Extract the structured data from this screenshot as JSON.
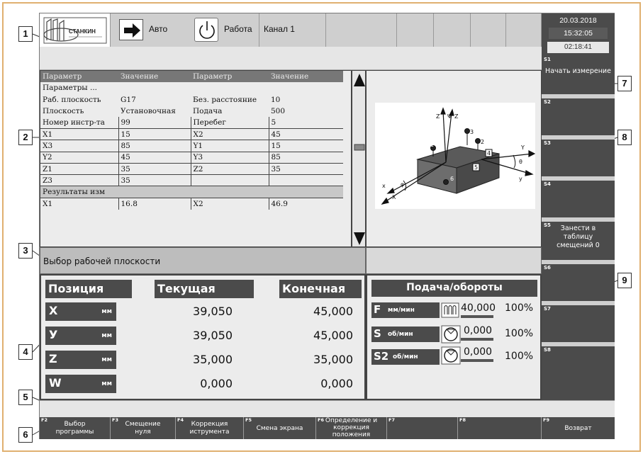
{
  "header": {
    "logo_text": "СТАНКИН",
    "mode_label": "Авто",
    "state_label": "Работа",
    "channel_label": "Канал 1",
    "date": "20.03.2018",
    "time": "15:32:05",
    "timer": "02:18:41"
  },
  "params_table": {
    "headers": [
      "Параметр",
      "Значение",
      "Параметр",
      "Значение"
    ],
    "rows": [
      [
        "Параметры ...",
        "",
        "",
        ""
      ],
      [
        "Раб. плоскость",
        "G17",
        "Без. расстояние",
        "10"
      ],
      [
        "Плоскость",
        "Установочная",
        "Подача",
        "500"
      ],
      [
        "Номер инстр-та",
        "99",
        "Перебег",
        "5"
      ],
      [
        "X1",
        "15",
        "X2",
        "45"
      ],
      [
        "X3",
        "85",
        "Y1",
        "15"
      ],
      [
        "Y2",
        "45",
        "Y3",
        "85"
      ],
      [
        "Z1",
        "35",
        "Z2",
        "35"
      ],
      [
        "Z3",
        "35",
        "",
        ""
      ],
      [
        "Результаты изм",
        "",
        "",
        ""
      ],
      [
        "X1",
        "16.8",
        "X2",
        "46.9"
      ]
    ]
  },
  "message": "Выбор рабочей плоскости",
  "position": {
    "title": "Позиция",
    "current_header": "Текущая",
    "final_header": "Конечная",
    "axes": [
      {
        "letter": "X",
        "unit": "мм",
        "current": "39,050",
        "final": "45,000"
      },
      {
        "letter": "У",
        "unit": "мм",
        "current": "39,050",
        "final": "45,000"
      },
      {
        "letter": "Z",
        "unit": "мм",
        "current": "35,000",
        "final": "35,000"
      },
      {
        "letter": "W",
        "unit": "мм",
        "current": "0,000",
        "final": "0,000"
      }
    ]
  },
  "feed": {
    "title": "Подача/обороты",
    "rows": [
      {
        "letter": "F",
        "unit": "мм/мин",
        "value": "40,000",
        "percent": "100%"
      },
      {
        "letter": "S",
        "unit": "об/мин",
        "value": "0,000",
        "percent": "100%"
      },
      {
        "letter": "S2",
        "unit": "об/мин",
        "value": "0,000",
        "percent": "100%"
      }
    ]
  },
  "softkeys": [
    {
      "num": "S1",
      "label": "Начать измерение"
    },
    {
      "num": "S2",
      "label": ""
    },
    {
      "num": "S3",
      "label": ""
    },
    {
      "num": "S4",
      "label": ""
    },
    {
      "num": "S5",
      "label": "Занести в таблицу смещений 0"
    },
    {
      "num": "S6",
      "label": ""
    },
    {
      "num": "S7",
      "label": ""
    },
    {
      "num": "S8",
      "label": ""
    }
  ],
  "function_keys": [
    {
      "num": "F2",
      "label": "Выбор программы"
    },
    {
      "num": "F3",
      "label": "Смещение нуля"
    },
    {
      "num": "F4",
      "label": "Коррекция иструмента"
    },
    {
      "num": "F5",
      "label": "Смена экрана"
    },
    {
      "num": "F6",
      "label": "Определение и коррекция положения"
    },
    {
      "num": "F7",
      "label": ""
    },
    {
      "num": "F8",
      "label": ""
    },
    {
      "num": "F9",
      "label": "Возврат"
    }
  ],
  "diagram_labels": {
    "z": "Z",
    "z_prime": "Z",
    "psi": "Ψ",
    "x": "X",
    "x_lower": "x",
    "y": "Y",
    "y_lower": "y",
    "theta": "θ",
    "phi": "φ",
    "p1": "1",
    "p2": "2",
    "p3": "3",
    "p4": "4",
    "p5": "5",
    "p6": "6"
  },
  "callouts": [
    "1",
    "2",
    "3",
    "4",
    "5",
    "6",
    "7",
    "8",
    "9"
  ]
}
